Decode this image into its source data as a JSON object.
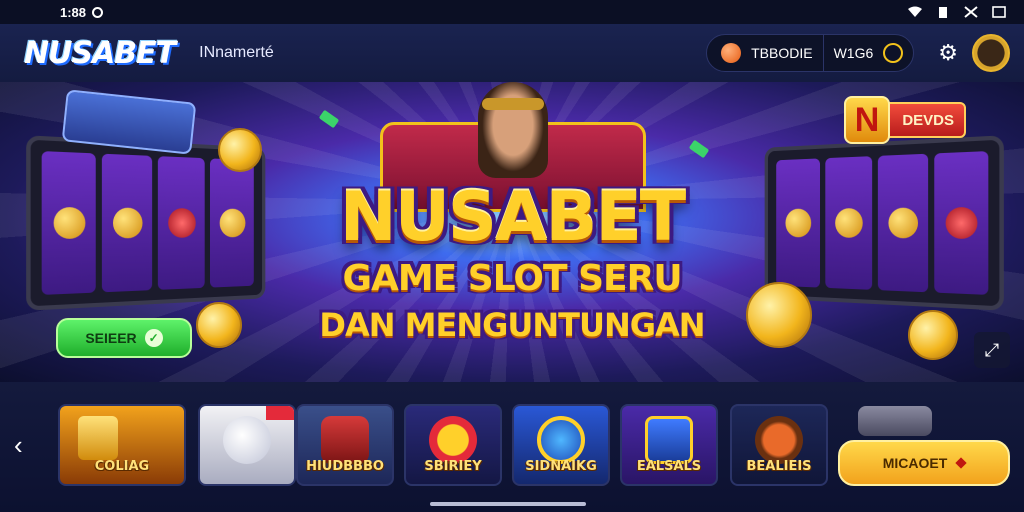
{
  "status_bar": {
    "time": "1:88",
    "icons": [
      "clock-icon",
      "wifi-icon",
      "battery-icon",
      "signal-off-icon",
      "cast-icon"
    ]
  },
  "header": {
    "logo": "NUSABET",
    "username": "INnamerté",
    "balance": {
      "label": "TBBODIE",
      "amount": "W1G6",
      "icons": [
        "coin-icon",
        "gold-ring-icon"
      ]
    },
    "settings_icon": "gear-icon",
    "avatar_icon": "avatar"
  },
  "banner": {
    "title": "NUSABET",
    "subtitle_line1": "GAME SLOT SERU",
    "subtitle_line2": "DAN MENGUNTUNGAN",
    "left_sign": "",
    "right_sign": {
      "badge": "N",
      "label": "DEVDS"
    },
    "green_button": {
      "label": "SEIEER",
      "icon": "chevron-down-icon"
    },
    "shrink_icon": "collapse-icon"
  },
  "games": {
    "prev_icon": "chevron-left-icon",
    "tiles": [
      {
        "label": "COLIAG",
        "icon": "coin-n-icon"
      },
      {
        "label": "",
        "icon": "shell-icon"
      },
      {
        "label": "HIUDBBBO",
        "icon": "bag-icon"
      },
      {
        "label": "SBIRIEY",
        "icon": "seven-icon"
      },
      {
        "label": "SIDNAIKG",
        "icon": "lightning-icon"
      },
      {
        "label": "EALSALS",
        "icon": "card-icon"
      },
      {
        "label": "BEALIEIS",
        "icon": "drum-icon"
      }
    ],
    "cta": {
      "label": "MICAOET",
      "icon": "diamond-icon"
    }
  },
  "colors": {
    "accent_gold": "#ffd02a",
    "brand_blue": "#1e6bff",
    "green": "#1fae2b",
    "background": "#0f1533"
  }
}
